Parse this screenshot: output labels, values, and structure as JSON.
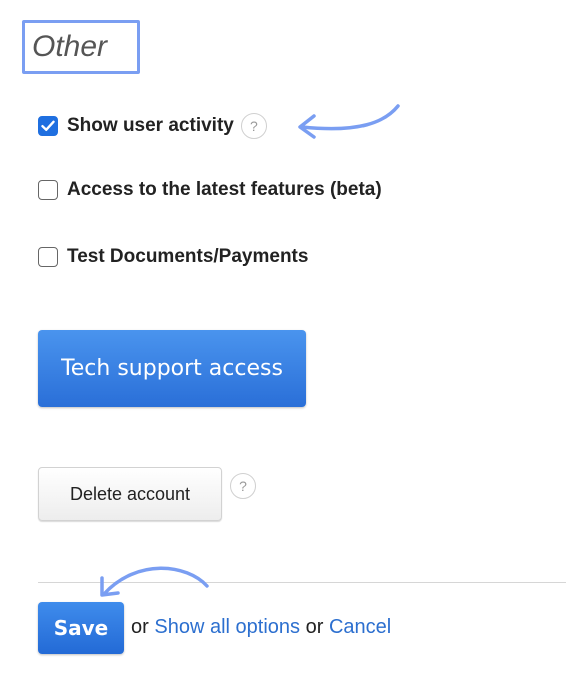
{
  "section": {
    "title": "Other"
  },
  "options": [
    {
      "label": "Show user activity",
      "checked": true,
      "help": "?"
    },
    {
      "label": "Access to the latest features (beta)",
      "checked": false
    },
    {
      "label": "Test Documents/Payments",
      "checked": false
    }
  ],
  "buttons": {
    "tech_support": "Tech support access",
    "delete_account": "Delete account",
    "delete_help": "?",
    "save": "Save"
  },
  "footer": {
    "or_1": "or",
    "show_all_options": "Show all options",
    "or_2": "or",
    "cancel": "Cancel"
  },
  "icons": {
    "checkmark": "check-icon",
    "help": "question-circle-icon",
    "annotation_arrow": "curved-arrow-icon"
  },
  "colors": {
    "accent": "#2a6fd8",
    "link": "#2c6fcf",
    "annotation": "#7a9ef2"
  }
}
